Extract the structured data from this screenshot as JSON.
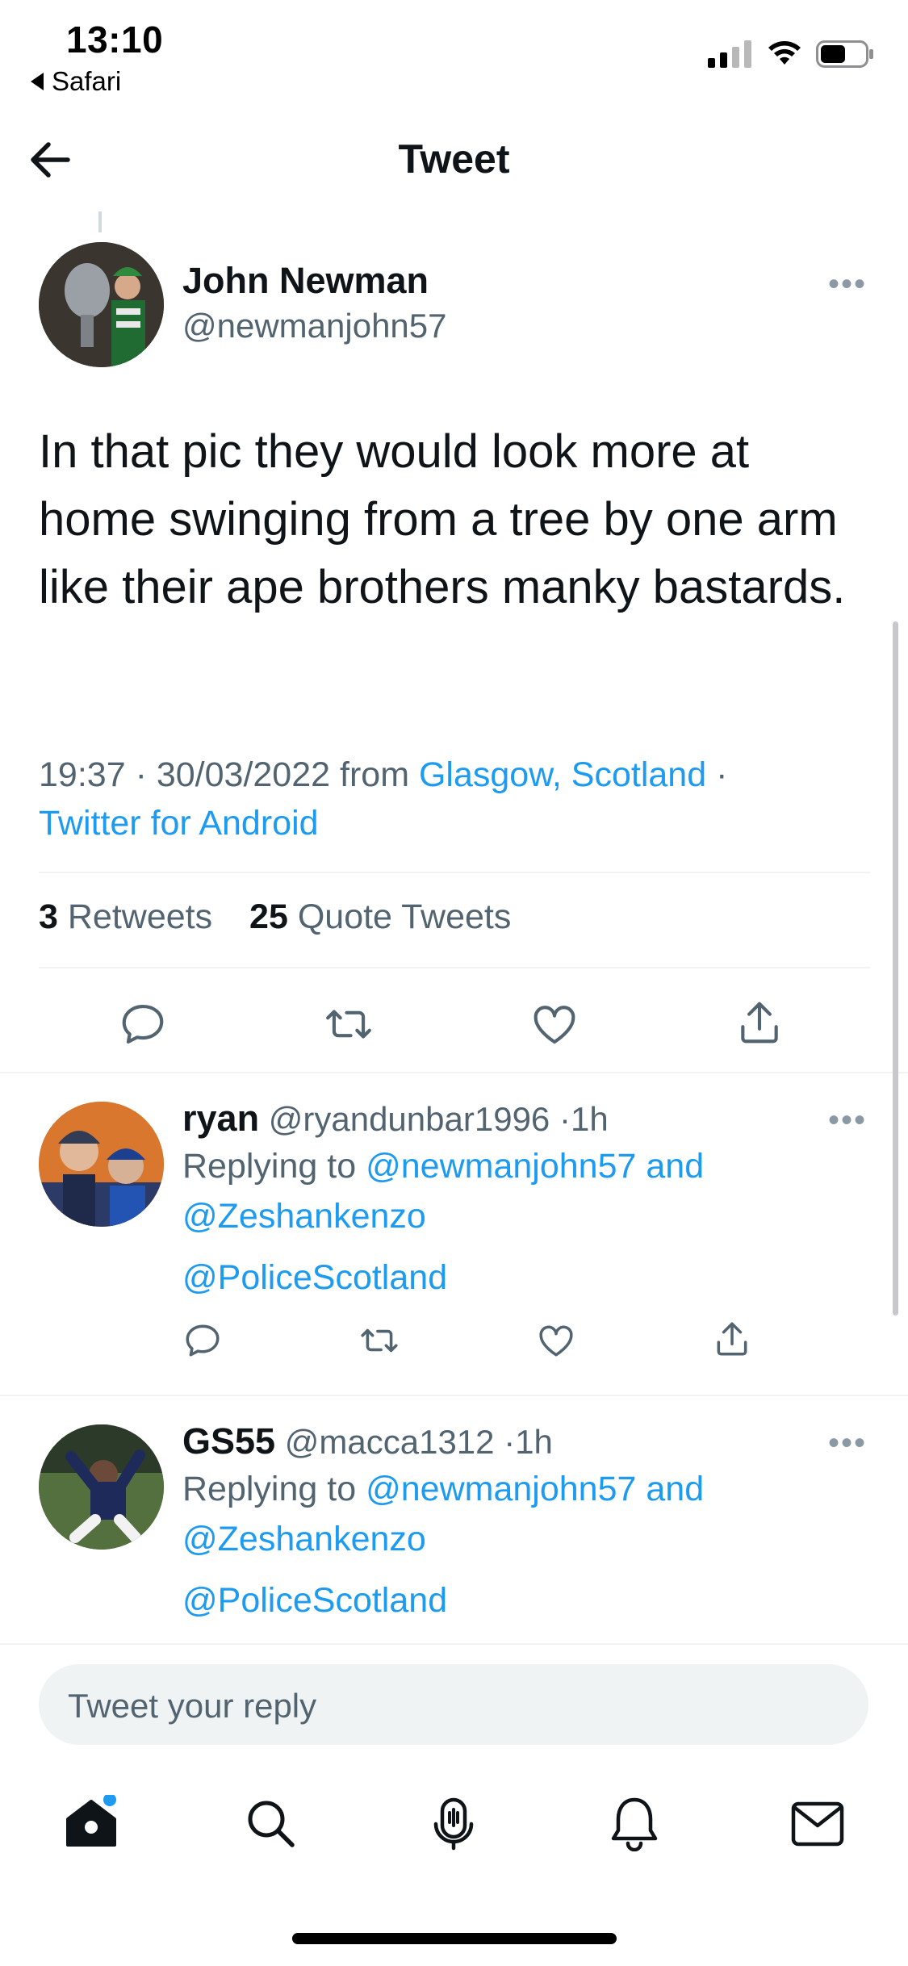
{
  "status_bar": {
    "time": "13:10",
    "back_app": "Safari"
  },
  "header": {
    "title": "Tweet",
    "back_icon": "arrow-left-icon"
  },
  "main_tweet": {
    "author_name": "John Newman",
    "author_handle": "@newmanjohn57",
    "text": "In that pic they would look more at home swinging from a tree by one arm like their ape brothers manky bastards.",
    "time": "19:37",
    "date": "30/03/2022",
    "from_label": "from",
    "location": "Glasgow, Scotland",
    "client": "Twitter for Android",
    "retweets_count": "3",
    "retweets_label": "Retweets",
    "quotes_count": "25",
    "quotes_label": "Quote Tweets"
  },
  "replies": [
    {
      "name": "ryan",
      "handle": "@ryandunbar1996",
      "age": "1h",
      "replying_prefix": "Replying to",
      "replying_to_1": "@newmanjohn57",
      "replying_and": "and",
      "replying_to_2": "@Zeshankenzo",
      "body": "@PoliceScotland"
    },
    {
      "name": "GS55",
      "handle": "@macca1312",
      "age": "1h",
      "replying_prefix": "Replying to",
      "replying_to_1": "@newmanjohn57",
      "replying_and": "and",
      "replying_to_2": "@Zeshankenzo",
      "body": "@PoliceScotland"
    }
  ],
  "composer": {
    "placeholder": "Tweet your reply"
  },
  "tab_bar": {
    "items": [
      "home-icon",
      "search-icon",
      "spaces-icon",
      "notifications-icon",
      "messages-icon"
    ]
  },
  "colors": {
    "link": "#1d9bf0",
    "secondary_text": "#536471",
    "primary_text": "#0f1419",
    "divider": "#eff3f4"
  }
}
